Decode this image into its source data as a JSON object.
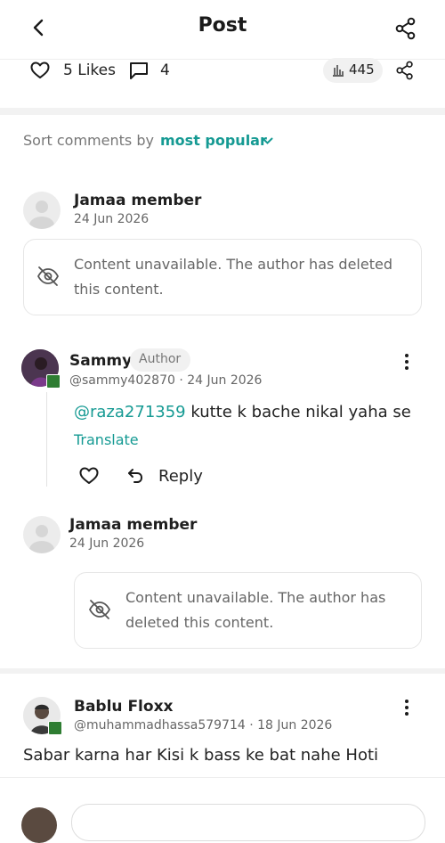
{
  "header": {
    "title": "Post"
  },
  "stats": {
    "likes": "5 Likes",
    "comments": "4",
    "views": "445"
  },
  "sort": {
    "label": "Sort comments by",
    "value": "most popular"
  },
  "comments": [
    {
      "name": "Jamaa member",
      "date": "24 Jun 2026",
      "content": "Content unavailable. The author has deleted this content."
    },
    {
      "name": "Sammy",
      "badge": "Author",
      "handle_date": "@sammy402870 · 24 Jun 2026",
      "mention": "@raza271359",
      "text": " kutte k bache nikal yaha se",
      "translate": "Translate",
      "reply": "Reply"
    },
    {
      "name": "Jamaa member",
      "date": "24 Jun 2026",
      "content": "Content unavailable. The author has deleted this content."
    },
    {
      "name": "Bablu Floxx",
      "handle_date": "@muhammadhassa579714 · 18 Jun 2026",
      "text": "Sabar karna har Kisi k bass ke bat nahe Hoti"
    }
  ],
  "colors": {
    "accent": "#159a93",
    "muted": "#777777",
    "band": "#f2f2f2"
  }
}
